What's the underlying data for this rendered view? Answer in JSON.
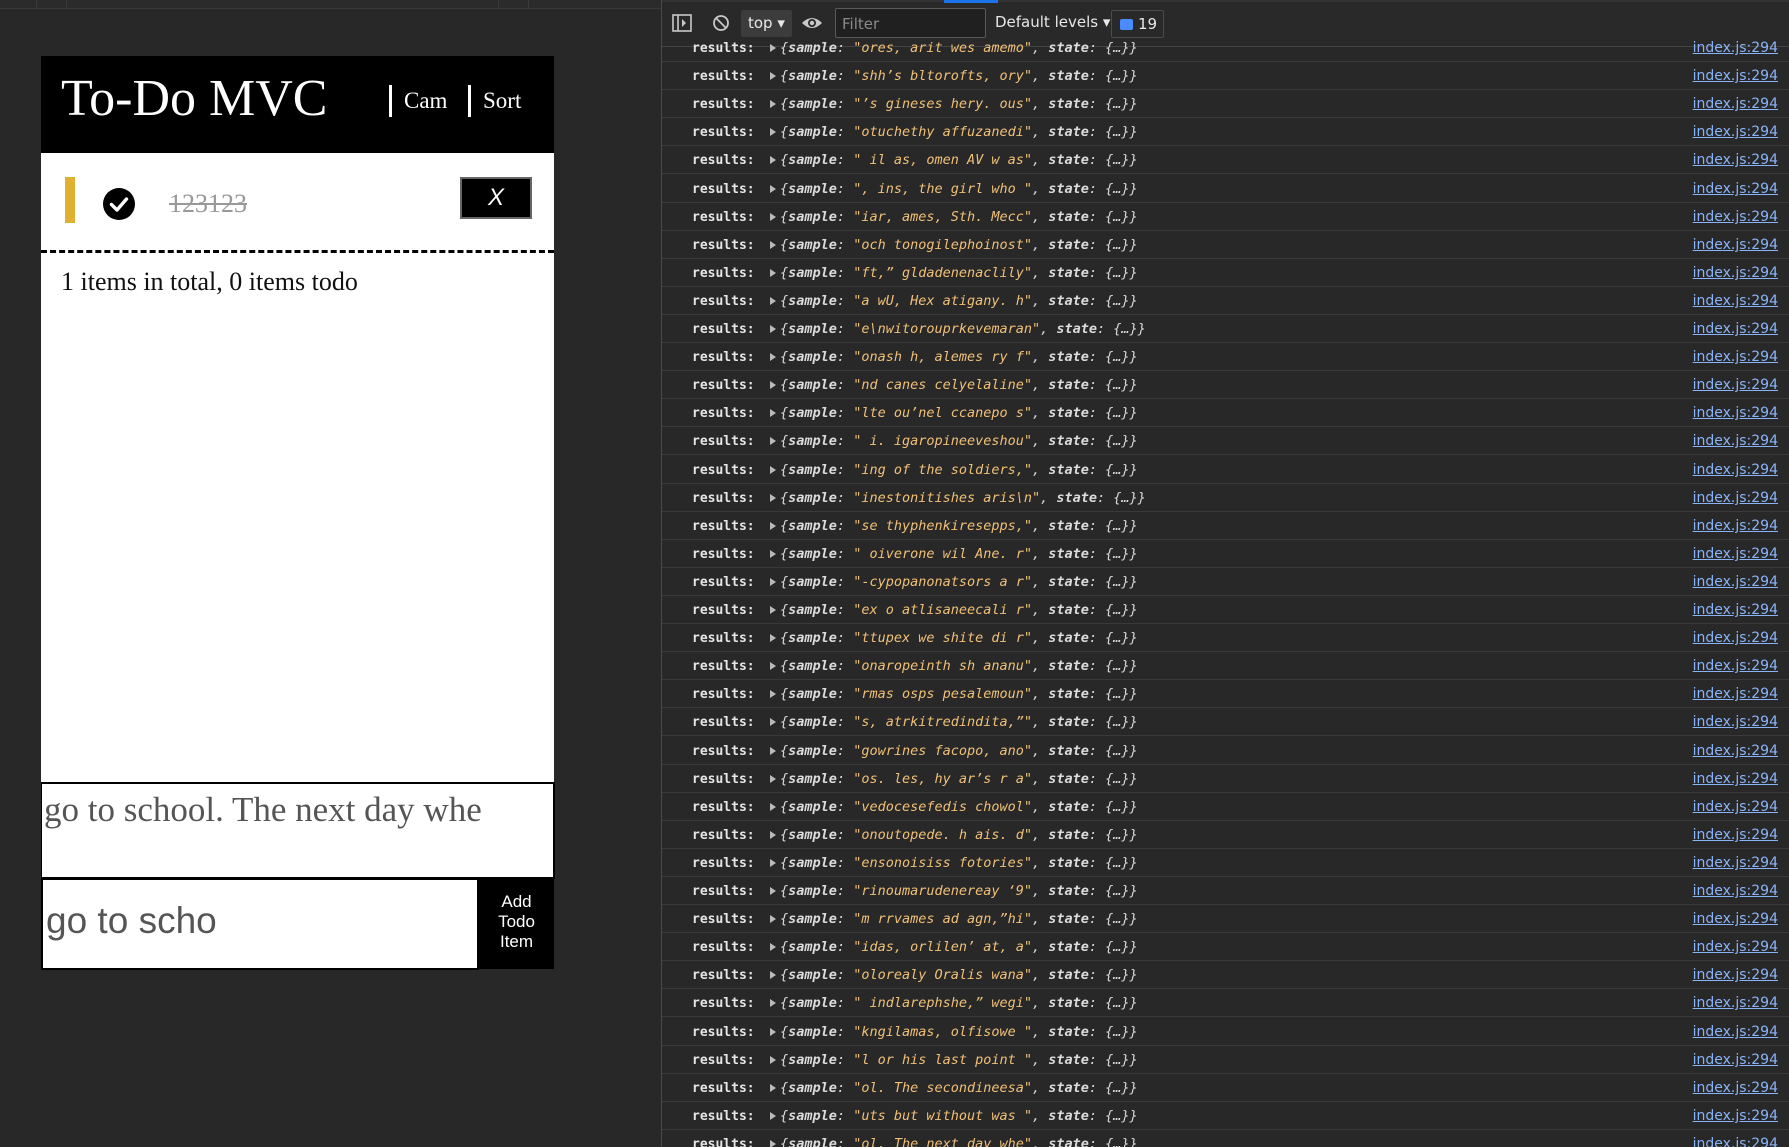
{
  "app": {
    "title": "To-Do MVC",
    "nav": {
      "cam_label": "Cam",
      "sort_label": "Sort"
    },
    "todo": {
      "text": "123123",
      "completed": true,
      "delete_label": "X",
      "marker_color": "#e0b030"
    },
    "summary": "1 items in total, 0 items todo",
    "long_input_value": "go to school. The next day whe",
    "short_input_value": "go to scho",
    "add_button_label": "Add Todo Item"
  },
  "devtools": {
    "context": "top",
    "filter_placeholder": "Filter",
    "levels": "Default levels",
    "issues_count": "19",
    "log_label": "results:",
    "source": "index.js:294",
    "logs": [
      "ores, arit wes amemo",
      "shh’s bltorofts, ory",
      "’s gineses hery. ous",
      "otuchethy affuzanedi",
      " il as, omen AV w as",
      ", ins, the girl who ",
      "iar, ames, Sth. Mecc",
      "och tonogilephoinost",
      "ft,” gldadenenaclily",
      "a wU, Hex atigany. h",
      "e\\nwitorouprkevemaran",
      "onash h, alemes ry f",
      "nd canes celyelaline",
      "lte ou’nel ccanepo s",
      " i. igaropineeveshou",
      "ing of the soldiers,",
      "inestonitishes aris\\n",
      "se thyphenkiresepps,",
      " oiverone wil Ane. r",
      "-cypopanonatsors a r",
      "ex o atlisaneecali r",
      "ttupex we shite di r",
      "onaropeinth sh ananu",
      "rmas osps pesalemoun",
      "s, atrkitredindita,”",
      "gowrines facopo, ano",
      "os. les, hy ar’s r a",
      "vedocesefedis chowol",
      "onoutopede. h ais. d",
      "ensonoisiss fotories",
      "rinoumarudenereay ‘9",
      "m rrvames ad agn,”hi",
      "idas, orlilen’ at, a",
      "olorealy Oralis wana",
      " indlarephshe,” wegi",
      "kngilamas, olfisowe ",
      "l or his last point ",
      "ol. The secondineesa",
      "uts but without was ",
      "ol. The next day whe"
    ]
  }
}
